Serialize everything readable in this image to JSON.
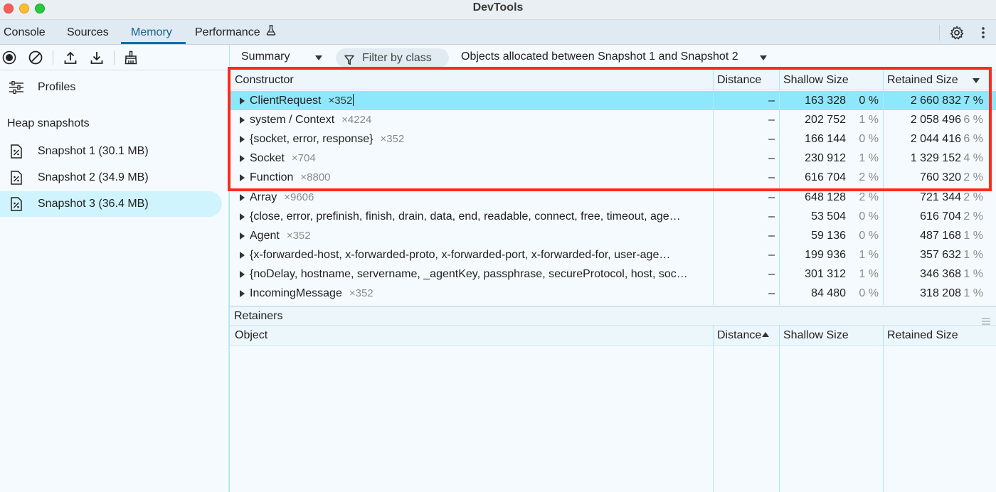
{
  "window": {
    "title": "DevTools"
  },
  "tabs": [
    {
      "label": "Console"
    },
    {
      "label": "Sources"
    },
    {
      "label": "Memory"
    },
    {
      "label": "Performance"
    }
  ],
  "sidebar": {
    "profiles_label": "Profiles",
    "heading": "Heap snapshots",
    "snapshots": [
      {
        "label": "Snapshot 1 (30.1 MB)"
      },
      {
        "label": "Snapshot 2 (34.9 MB)"
      },
      {
        "label": "Snapshot 3 (36.4 MB)"
      }
    ]
  },
  "filterbar": {
    "view": "Summary",
    "filter_placeholder": "Filter by class",
    "range": "Objects allocated between Snapshot 1 and Snapshot 2"
  },
  "table": {
    "headers": {
      "constructor": "Constructor",
      "distance": "Distance",
      "shallow": "Shallow Size",
      "retained": "Retained Size"
    },
    "rows": [
      {
        "name": "ClientRequest",
        "count": "×352",
        "distance": "–",
        "shallow": "163 328",
        "shallow_pct": "0 %",
        "retained": "2 660 832",
        "retained_pct": "7 %"
      },
      {
        "name": "system / Context",
        "count": "×4224",
        "distance": "–",
        "shallow": "202 752",
        "shallow_pct": "1 %",
        "retained": "2 058 496",
        "retained_pct": "6 %"
      },
      {
        "name": "{socket, error, response}",
        "count": "×352",
        "distance": "–",
        "shallow": "166 144",
        "shallow_pct": "0 %",
        "retained": "2 044 416",
        "retained_pct": "6 %"
      },
      {
        "name": "Socket",
        "count": "×704",
        "distance": "–",
        "shallow": "230 912",
        "shallow_pct": "1 %",
        "retained": "1 329 152",
        "retained_pct": "4 %"
      },
      {
        "name": "Function",
        "count": "×8800",
        "distance": "–",
        "shallow": "616 704",
        "shallow_pct": "2 %",
        "retained": "760 320",
        "retained_pct": "2 %"
      },
      {
        "name": "Array",
        "count": "×9606",
        "distance": "–",
        "shallow": "648 128",
        "shallow_pct": "2 %",
        "retained": "721 344",
        "retained_pct": "2 %"
      },
      {
        "name": "{close, error, prefinish, finish, drain, data, end, readable, connect, free, timeout, age…",
        "count": "",
        "distance": "–",
        "shallow": "53 504",
        "shallow_pct": "0 %",
        "retained": "616 704",
        "retained_pct": "2 %"
      },
      {
        "name": "Agent",
        "count": "×352",
        "distance": "–",
        "shallow": "59 136",
        "shallow_pct": "0 %",
        "retained": "487 168",
        "retained_pct": "1 %"
      },
      {
        "name": "{x-forwarded-host, x-forwarded-proto, x-forwarded-port, x-forwarded-for, user-age…",
        "count": "",
        "distance": "–",
        "shallow": "199 936",
        "shallow_pct": "1 %",
        "retained": "357 632",
        "retained_pct": "1 %"
      },
      {
        "name": "{noDelay, hostname, servername, _agentKey, passphrase, secureProtocol, host, soc…",
        "count": "",
        "distance": "–",
        "shallow": "301 312",
        "shallow_pct": "1 %",
        "retained": "346 368",
        "retained_pct": "1 %"
      },
      {
        "name": "IncomingMessage",
        "count": "×352",
        "distance": "–",
        "shallow": "84 480",
        "shallow_pct": "0 %",
        "retained": "318 208",
        "retained_pct": "1 %"
      }
    ]
  },
  "retainers": {
    "title": "Retainers",
    "headers": {
      "object": "Object",
      "distance": "Distance",
      "shallow": "Shallow Size",
      "retained": "Retained Size"
    }
  },
  "colors": {
    "selected_row": "#8ee8fb",
    "accent": "#155e8c",
    "highlight_box": "#ff2a1a"
  },
  "icons": [
    "record-icon",
    "clear-icon",
    "upload-icon",
    "download-icon",
    "broom-icon",
    "settings-gear-icon",
    "more-vertical-icon",
    "flask-icon",
    "sliders-icon",
    "snapshot-icon",
    "filter-icon",
    "drag-handle-icon"
  ]
}
